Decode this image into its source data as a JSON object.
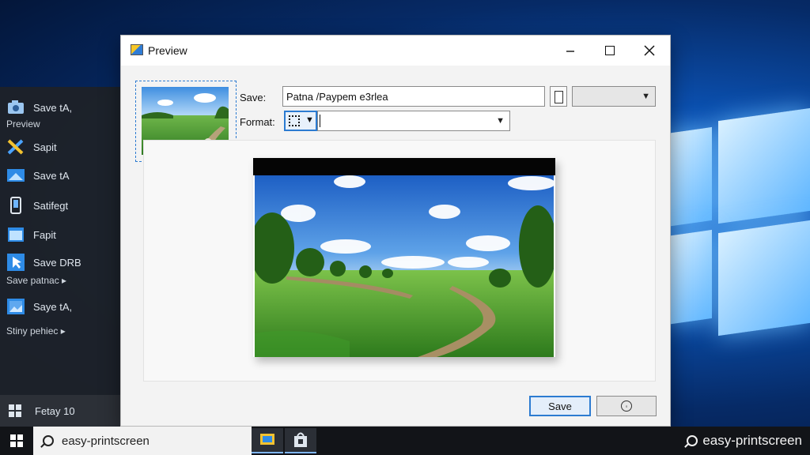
{
  "desktop": {
    "start_menu": {
      "items": [
        {
          "label": "Save tA,",
          "sublabel": "Preview",
          "icon": "camera-icon"
        },
        {
          "label": "Sapit",
          "icon": "scissors-icon"
        },
        {
          "label": "Save tA",
          "icon": "screen-capture-icon"
        },
        {
          "label": "Satifegt",
          "icon": "phone-icon"
        },
        {
          "label": "Fapit",
          "icon": "window-icon"
        },
        {
          "label": "Save DRB",
          "sublabel": "Save patnac ▸",
          "icon": "pointer-icon"
        },
        {
          "label": "Saye tA,",
          "sublabel": "Stiny pehiec ▸",
          "icon": "image-icon"
        }
      ],
      "power_label": "Fetay 10"
    }
  },
  "dialog": {
    "title": "Preview",
    "save_label": "Save:",
    "save_value": "Patna /Paypem e3rlea",
    "format_label": "Format:",
    "save_button": "Save",
    "cancel_glyph": "◦"
  },
  "taskbar": {
    "search_text": "easy-printscreen",
    "tray_text": "easy-printscreen"
  },
  "colors": {
    "accent": "#2c7bd1",
    "taskbar": "#121418",
    "start_menu": "#1e2228"
  }
}
